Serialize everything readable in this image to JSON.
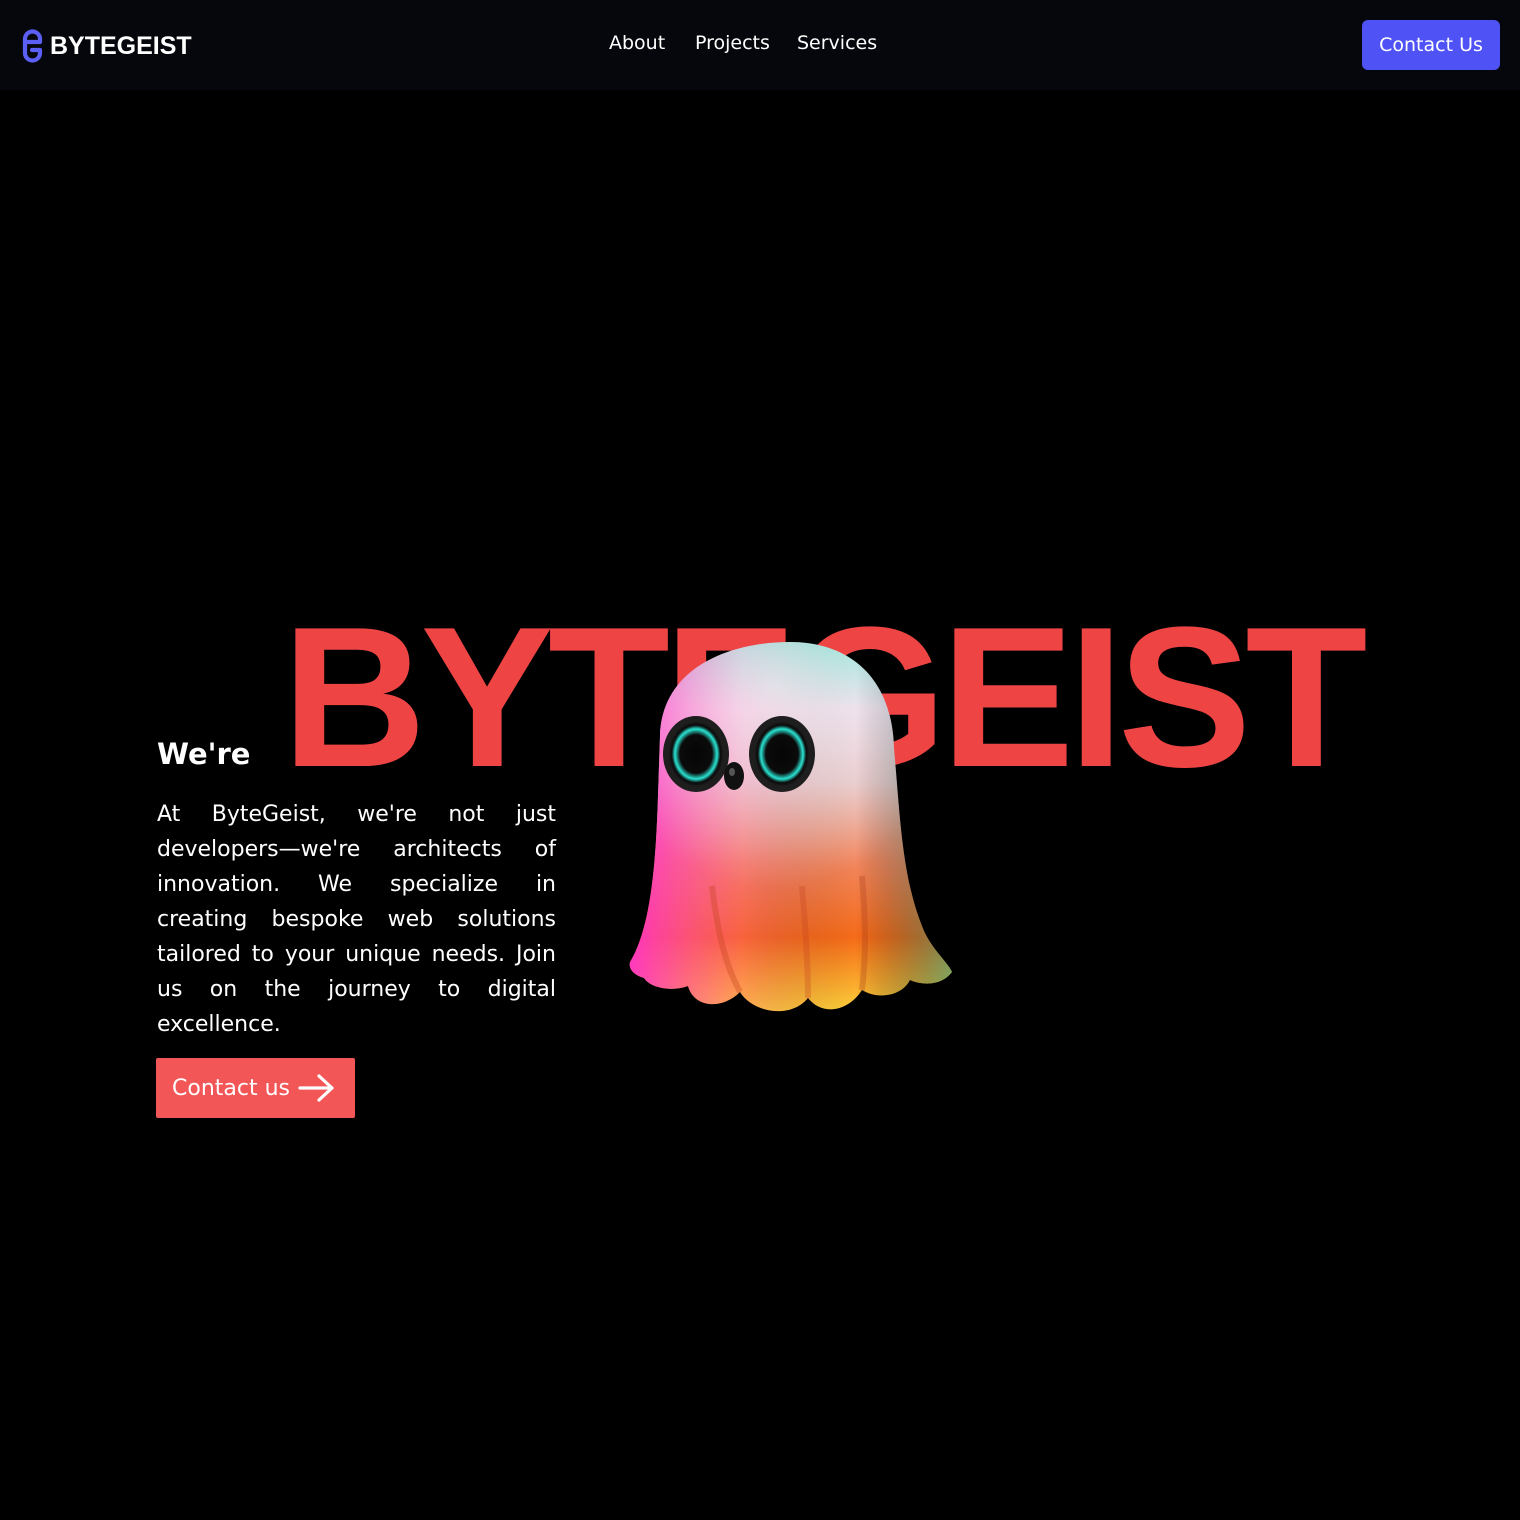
{
  "brand": {
    "name": "BYTEGEIST",
    "icon": "bytegeist-logo-icon",
    "accent_color": "#5b5ff6"
  },
  "nav": {
    "links": [
      {
        "label": "About"
      },
      {
        "label": "Projects"
      },
      {
        "label": "Services"
      }
    ],
    "cta_label": "Contact Us",
    "cta_color": "#4f52f5"
  },
  "hero": {
    "prefix": "We're",
    "headline": "BYTEGEIST",
    "headline_color": "#ef4444",
    "description": "At ByteGeist, we're not just developers—we're architects of innovation. We specialize in creating bespoke web solutions tailored to your unique needs. Join us on the journey to digital excellence.",
    "mascot": "rainbow-ghost-illustration",
    "cta_label": "Contact us",
    "cta_icon": "arrow-right-icon",
    "cta_color": "#f25656"
  },
  "colors": {
    "background": "#000000",
    "navbar": "#06070c"
  }
}
